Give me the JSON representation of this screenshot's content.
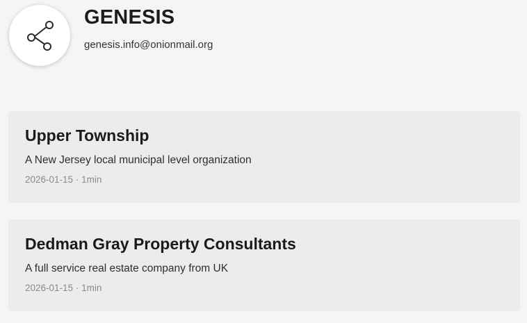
{
  "header": {
    "title": "GENESIS",
    "email": "genesis.info@onionmail.org",
    "avatar_icon": "share-nodes-icon"
  },
  "posts": [
    {
      "title": "Upper Township",
      "description": "A New Jersey local municipal level organization",
      "date": "2026-01-15",
      "separator": "·",
      "read_time": "1min"
    },
    {
      "title": "Dedman Gray Property Consultants",
      "description": "A full service real estate company from UK",
      "date": "2026-01-15",
      "separator": "·",
      "read_time": "1min"
    }
  ]
}
